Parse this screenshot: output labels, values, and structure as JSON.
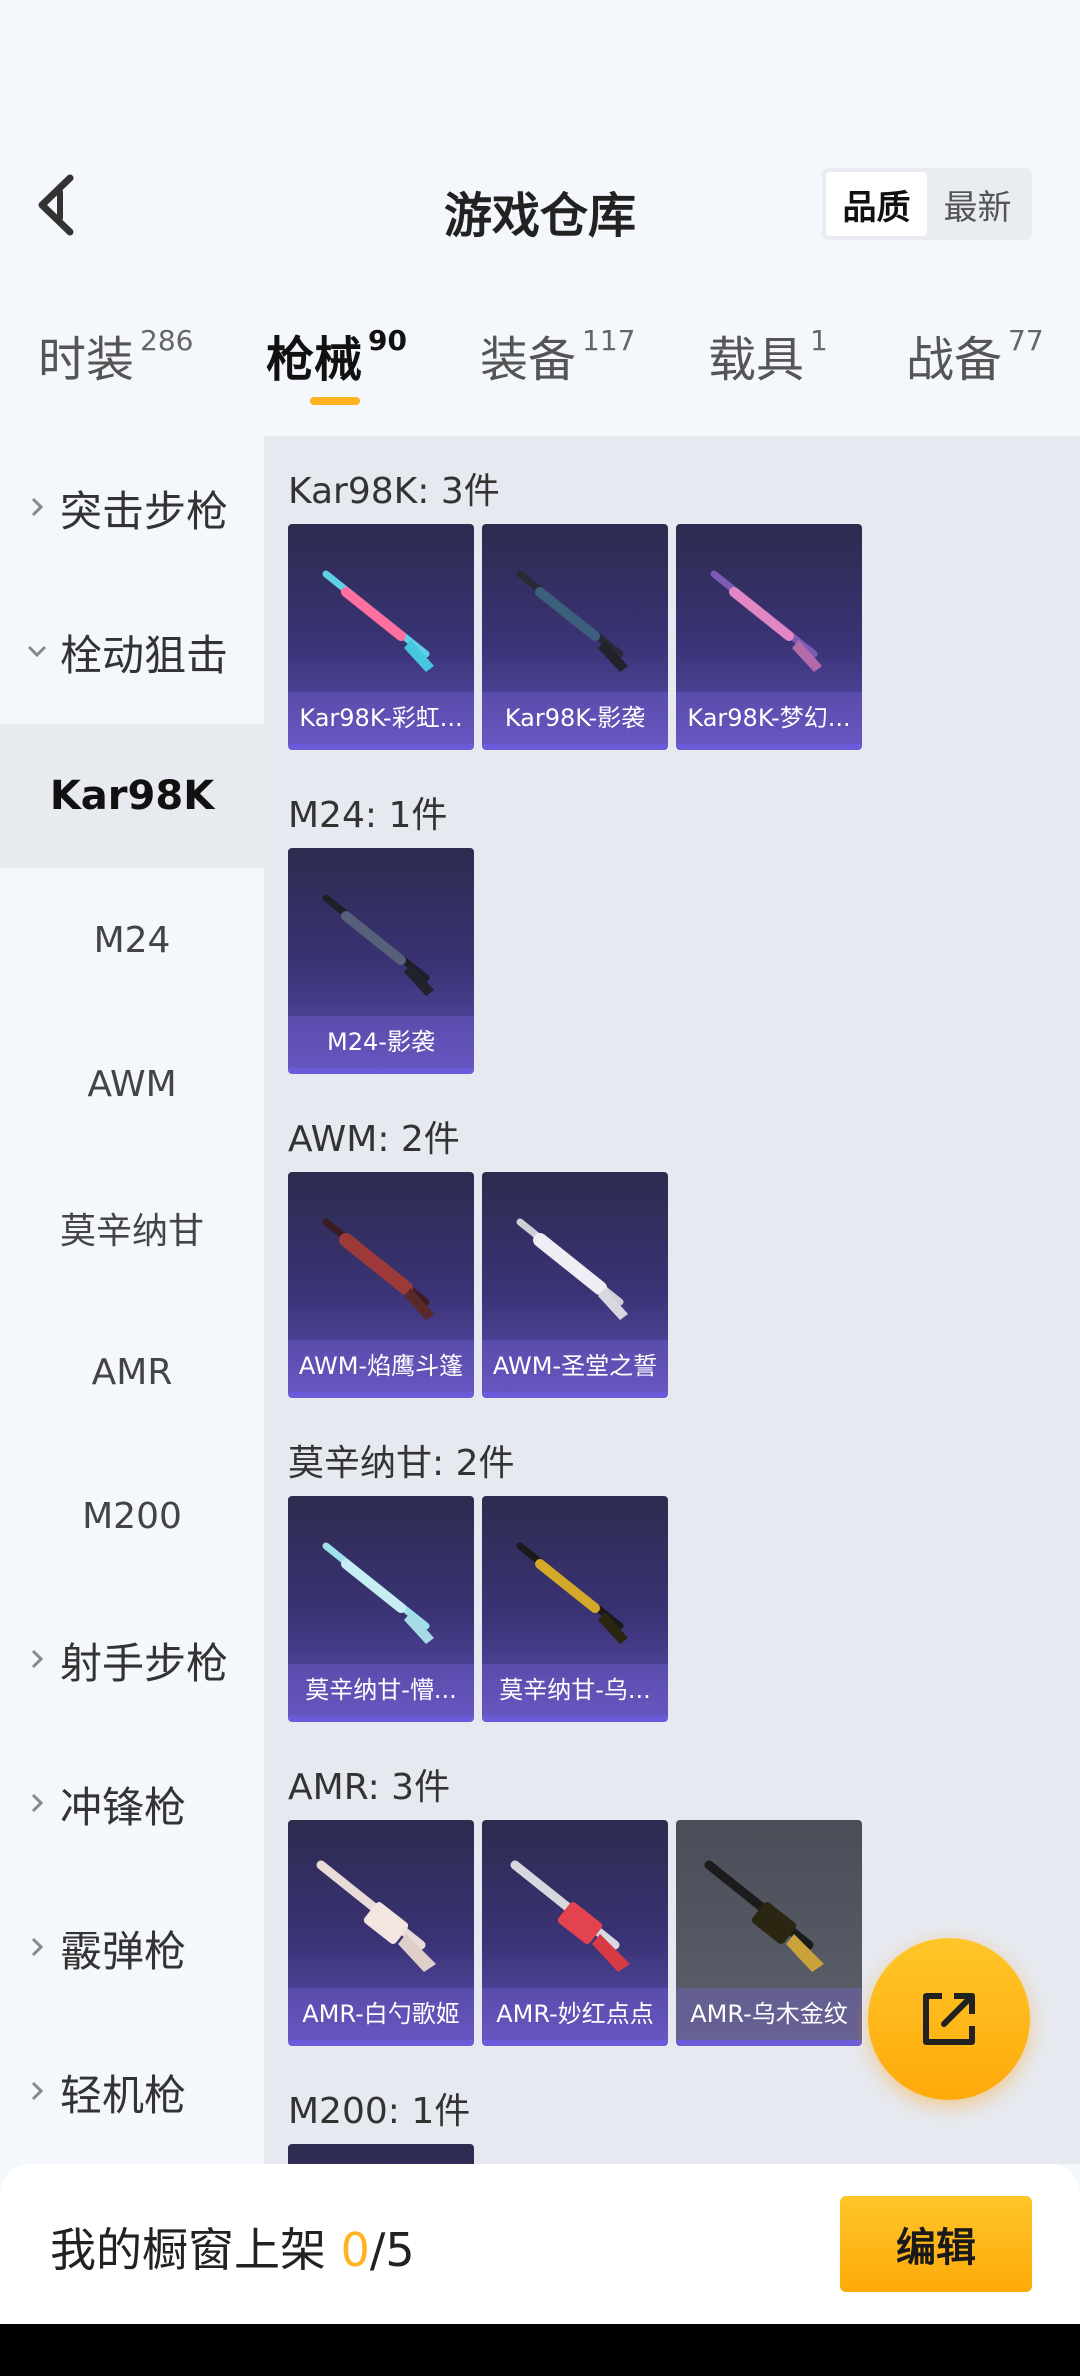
{
  "header": {
    "title": "游戏仓库",
    "sort_options": [
      "品质",
      "最新"
    ],
    "sort_selected": "品质"
  },
  "tabs": [
    {
      "label": "时装",
      "count": "286"
    },
    {
      "label": "枪械",
      "count": "90"
    },
    {
      "label": "装备",
      "count": "117"
    },
    {
      "label": "载具",
      "count": "1"
    },
    {
      "label": "战备",
      "count": "77"
    }
  ],
  "sidebar": {
    "items": [
      {
        "label": "突击步枪",
        "type": "category",
        "expanded": false
      },
      {
        "label": "栓动狙击",
        "type": "category",
        "expanded": true
      },
      {
        "label": "Kar98K",
        "type": "sub",
        "selected": true
      },
      {
        "label": "M24",
        "type": "sub"
      },
      {
        "label": "AWM",
        "type": "sub"
      },
      {
        "label": "莫辛纳甘",
        "type": "sub"
      },
      {
        "label": "AMR",
        "type": "sub"
      },
      {
        "label": "M200",
        "type": "sub"
      },
      {
        "label": "射手步枪",
        "type": "category",
        "expanded": false
      },
      {
        "label": "冲锋枪",
        "type": "category",
        "expanded": false
      },
      {
        "label": "霰弹枪",
        "type": "category",
        "expanded": false
      },
      {
        "label": "轻机枪",
        "type": "category",
        "expanded": false
      }
    ]
  },
  "sections": [
    {
      "title": "Kar98K: 3件",
      "items": [
        "Kar98K-彩虹...",
        "Kar98K-影袭",
        "Kar98K-梦幻..."
      ]
    },
    {
      "title": "M24: 1件",
      "items": [
        "M24-影袭"
      ]
    },
    {
      "title": "AWM: 2件",
      "items": [
        "AWM-焰鹰斗篷",
        "AWM-圣堂之誓"
      ]
    },
    {
      "title": "莫辛纳甘: 2件",
      "items": [
        "莫辛纳甘-懵...",
        "莫辛纳甘-乌..."
      ]
    },
    {
      "title": "AMR: 3件",
      "items": [
        "AMR-白勺歌姬",
        "AMR-妙红点点",
        "AMR-乌木金纹"
      ]
    },
    {
      "title": "M200: 1件",
      "items": []
    }
  ],
  "footer": {
    "prefix": "我的橱窗上架 ",
    "current": "0",
    "total": "/5",
    "edit_label": "编辑"
  }
}
